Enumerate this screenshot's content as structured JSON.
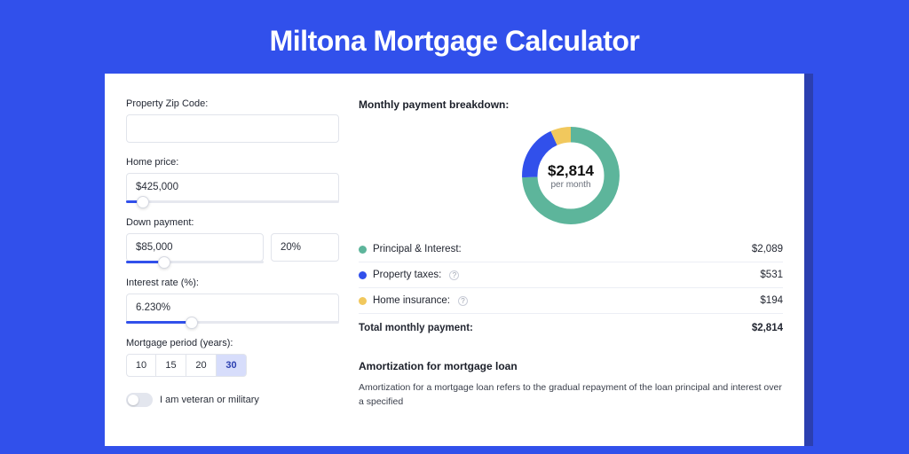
{
  "page_title": "Miltona Mortgage Calculator",
  "form": {
    "zip_label": "Property Zip Code:",
    "zip_value": "",
    "home_price_label": "Home price:",
    "home_price_value": "$425,000",
    "home_price_slider_pct": 8,
    "down_payment_label": "Down payment:",
    "down_payment_amount": "$85,000",
    "down_payment_pct": "20%",
    "down_payment_slider_pct": 20,
    "interest_label": "Interest rate (%):",
    "interest_value": "6.230%",
    "interest_slider_pct": 31,
    "period_label": "Mortgage period (years):",
    "periods": [
      "10",
      "15",
      "20",
      "30"
    ],
    "period_active": "30",
    "veteran_label": "I am veteran or military"
  },
  "breakdown": {
    "title": "Monthly payment breakdown:",
    "center_amount": "$2,814",
    "center_sub": "per month",
    "items": [
      {
        "label": "Principal & Interest:",
        "value": "$2,089",
        "color": "#5db59b",
        "has_info": false
      },
      {
        "label": "Property taxes:",
        "value": "$531",
        "color": "#3150eb",
        "has_info": true
      },
      {
        "label": "Home insurance:",
        "value": "$194",
        "color": "#f1c85d",
        "has_info": true
      }
    ],
    "total_label": "Total monthly payment:",
    "total_value": "$2,814"
  },
  "amort": {
    "title": "Amortization for mortgage loan",
    "text": "Amortization for a mortgage loan refers to the gradual repayment of the loan principal and interest over a specified"
  },
  "chart_data": {
    "type": "pie",
    "title": "Monthly payment breakdown",
    "series": [
      {
        "name": "Principal & Interest",
        "value": 2089,
        "color": "#5db59b"
      },
      {
        "name": "Property taxes",
        "value": 531,
        "color": "#3150eb"
      },
      {
        "name": "Home insurance",
        "value": 194,
        "color": "#f1c85d"
      }
    ],
    "total": 2814,
    "unit": "USD / month"
  }
}
